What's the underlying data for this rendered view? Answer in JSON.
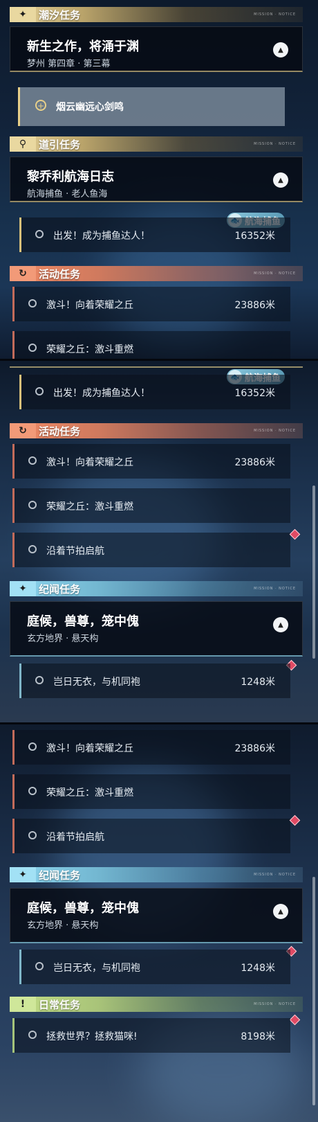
{
  "labels": {
    "tide": "潮汐任务",
    "guide": "道引任务",
    "activity": "活动任务",
    "chronicle": "纪闻任务",
    "daily": "日常任务",
    "deco": "MISSION · NOTICE"
  },
  "icons": {
    "tide": "✦",
    "guide": "⚲",
    "activity": "↻",
    "chronicle": "✦",
    "daily": "!",
    "expand": "▲",
    "badge": "🐟"
  },
  "quests": {
    "tide_main": {
      "title": "新生之作，将涌于渊",
      "subtitle": "梦州 第四章 · 第三幕"
    },
    "tide_step": "烟云幽远心剑鸣",
    "guide_main": {
      "title": "黎乔利航海日志",
      "subtitle": "航海捕鱼 · 老人鱼海"
    },
    "guide_step": {
      "text": "出发！成为捕鱼达人！",
      "dist": "16352米",
      "badge": "航海捕鱼"
    },
    "act1": {
      "text": "激斗！向着荣耀之丘",
      "dist": "23886米"
    },
    "act2": {
      "text": "荣耀之丘：激斗重燃"
    },
    "act3": {
      "text": "沿着节拍启航"
    },
    "chron_main": {
      "title": "庭候，兽尊，笼中傀",
      "subtitle": "玄方地界 · 悬天构"
    },
    "chron_step": {
      "text": "岂日无衣，与机同袍",
      "dist": "1248米"
    },
    "daily_step": {
      "text": "拯救世界？拯救猫咪!",
      "dist": "8198米"
    }
  },
  "colors": {
    "gold": "#e7d49a",
    "orange": "#f08a65",
    "blue": "#8dd6ef",
    "green": "#c3de86",
    "marker": "#e04a64"
  }
}
